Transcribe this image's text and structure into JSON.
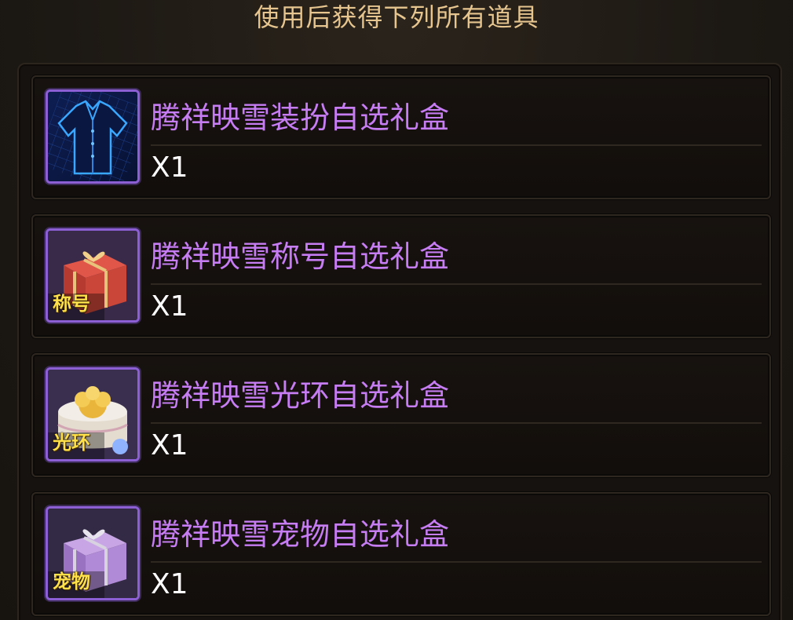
{
  "header": {
    "title": "使用后获得下列所有道具"
  },
  "items": [
    {
      "name": "腾祥映雪装扮自选礼盒",
      "quantity": "X1",
      "icon": "costume-shirt-icon",
      "badge": ""
    },
    {
      "name": "腾祥映雪称号自选礼盒",
      "quantity": "X1",
      "icon": "red-gift-box-icon",
      "badge": "称号"
    },
    {
      "name": "腾祥映雪光环自选礼盒",
      "quantity": "X1",
      "icon": "white-gift-box-icon",
      "badge": "光环"
    },
    {
      "name": "腾祥映雪宠物自选礼盒",
      "quantity": "X1",
      "icon": "purple-gift-box-icon",
      "badge": "宠物"
    }
  ],
  "colors": {
    "title": "#e6c58f",
    "item_name": "#c67cf2",
    "icon_border": "#8d5fd4",
    "quantity": "#ffffff"
  }
}
